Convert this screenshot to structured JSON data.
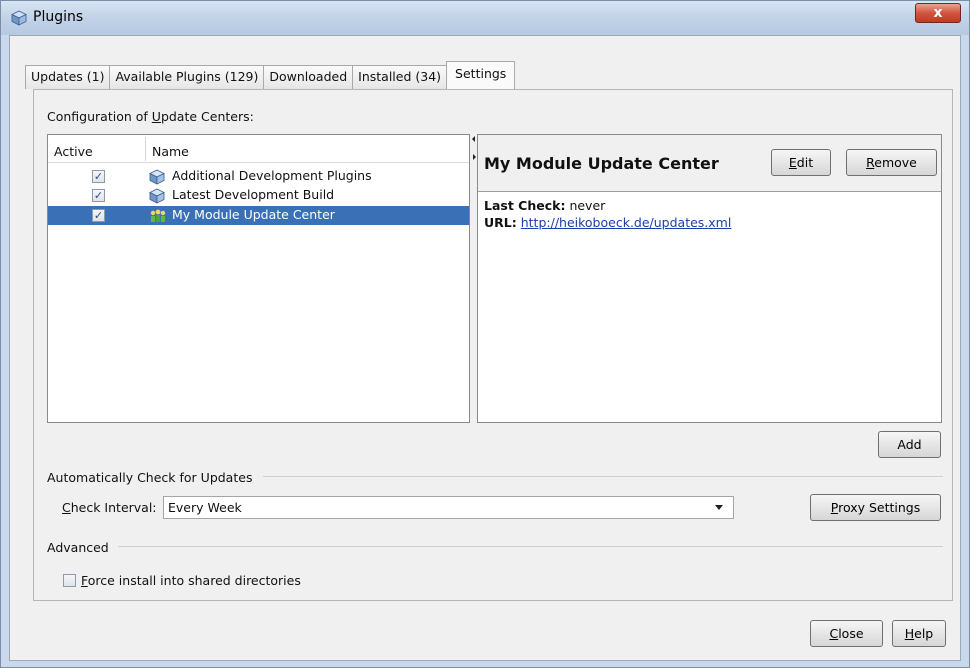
{
  "window": {
    "title": "Plugins",
    "close_glyph": "x"
  },
  "tabs": [
    {
      "label": "Updates (1)"
    },
    {
      "label": "Available Plugins (129)"
    },
    {
      "label": "Downloaded"
    },
    {
      "label": "Installed (34)"
    },
    {
      "label": "Settings",
      "active": true
    }
  ],
  "config": {
    "label_pre": "Configuration of ",
    "label_mnemonic": "U",
    "label_post": "pdate Centers:",
    "columns": {
      "active": "Active",
      "name": "Name"
    },
    "rows": [
      {
        "active": true,
        "name": "Additional Development Plugins",
        "icon": "cube-icon"
      },
      {
        "active": true,
        "name": "Latest Development Build",
        "icon": "cube-icon"
      },
      {
        "active": true,
        "name": "My Module Update Center",
        "icon": "people-icon",
        "selected": true
      }
    ]
  },
  "detail": {
    "title": "My Module Update Center",
    "edit_mnemonic": "E",
    "edit_rest": "dit",
    "remove_mnemonic": "R",
    "remove_rest": "emove",
    "last_check_label": "Last Check:",
    "last_check_value": "never",
    "url_label": "URL:",
    "url_value": "http://heikoboeck.de/updates.xml"
  },
  "add_button": "Add",
  "auto_check": {
    "section": "Automatically Check for Updates",
    "interval_mnemonic": "C",
    "interval_rest": "heck Interval:",
    "interval_value": "Every Week",
    "proxy_mnemonic": "P",
    "proxy_rest": "roxy Settings"
  },
  "advanced": {
    "section": "Advanced",
    "force_mnemonic": "F",
    "force_rest": "orce install into shared directories",
    "force_checked": false
  },
  "footer": {
    "close_mnemonic": "C",
    "close_rest": "lose",
    "help_mnemonic": "H",
    "help_rest": "elp"
  },
  "colors": {
    "selection": "#3a70b6",
    "link": "#1a3ea8",
    "titlebar": "#c3d4e8"
  }
}
